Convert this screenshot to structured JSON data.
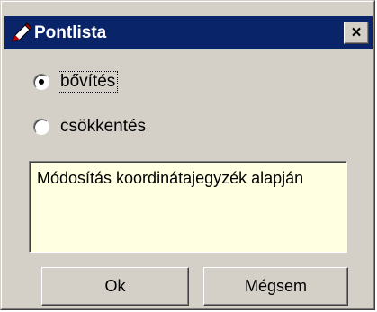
{
  "window": {
    "title": "Pontlista",
    "app_icon": "pencil-icon",
    "close_glyph": "×"
  },
  "options": [
    {
      "label": "bővítés",
      "selected": true
    },
    {
      "label": "csökkentés",
      "selected": false
    }
  ],
  "description": "Módosítás koordinátajegyzék alapján",
  "buttons": {
    "ok_label": "Ok",
    "cancel_label": "Mégsem"
  },
  "colors": {
    "titlebar": "#0a246a",
    "title_text": "#ffffff",
    "dialog_bg": "#d4d0c8",
    "description_bg": "#ffffe1"
  }
}
